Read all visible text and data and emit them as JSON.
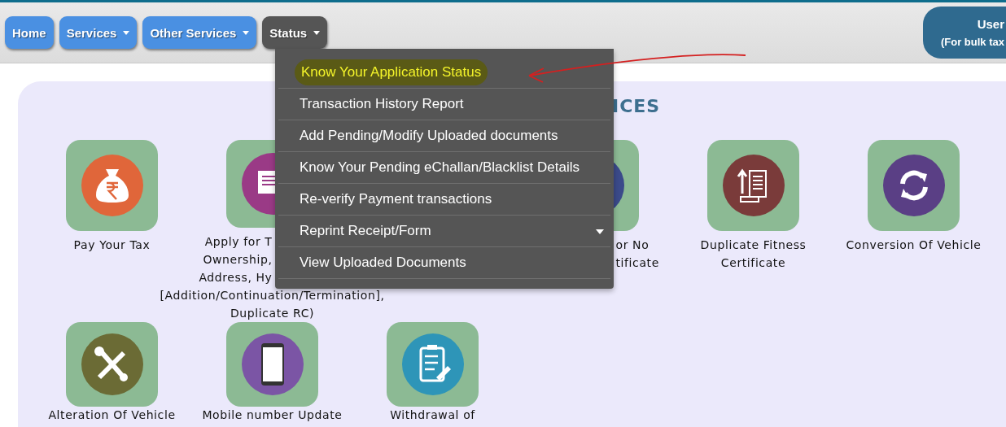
{
  "nav": [
    {
      "label": "Home",
      "dropdown": false,
      "selected": false
    },
    {
      "label": "Services",
      "dropdown": true,
      "selected": false
    },
    {
      "label": "Other Services",
      "dropdown": true,
      "selected": false
    },
    {
      "label": "Status",
      "dropdown": true,
      "selected": true
    }
  ],
  "user_button": {
    "title": "User",
    "subtitle": "(For bulk tax"
  },
  "heading": "ICES",
  "tiles_row1": [
    {
      "label_lines": [
        "Pay Your Tax"
      ]
    },
    {
      "label_lines": [
        "Apply for T",
        "Ownership,",
        "Address, Hy",
        "[Addition/Continuation/Termination],",
        "Duplicate RC)"
      ]
    },
    {
      "label_lines": [
        "or No",
        "tificate"
      ]
    },
    {
      "label_lines": [
        "Duplicate Fitness",
        "Certificate"
      ]
    },
    {
      "label_lines": [
        "Conversion Of Vehicle"
      ]
    }
  ],
  "tiles_row2": [
    {
      "label_lines": [
        "Alteration Of Vehicle"
      ]
    },
    {
      "label_lines": [
        "Mobile number Update"
      ]
    },
    {
      "label_lines": [
        "Withdrawal of"
      ]
    }
  ],
  "status_menu": [
    {
      "label": "Know Your Application Status",
      "selected": true,
      "submenu": false
    },
    {
      "label": "Transaction History Report",
      "selected": false,
      "submenu": false
    },
    {
      "label": "Add Pending/Modify Uploaded documents",
      "selected": false,
      "submenu": false
    },
    {
      "label": "Know Your Pending eChallan/Blacklist Details",
      "selected": false,
      "submenu": false
    },
    {
      "label": "Re-verify Payment transactions",
      "selected": false,
      "submenu": false
    },
    {
      "label": "Reprint Receipt/Form",
      "selected": false,
      "submenu": true
    },
    {
      "label": "View Uploaded Documents",
      "selected": false,
      "submenu": false
    }
  ]
}
